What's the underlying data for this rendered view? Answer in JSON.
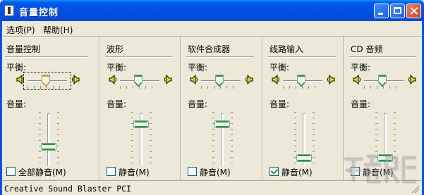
{
  "window": {
    "title": "音量控制"
  },
  "menu": [
    {
      "label": "选项(P)"
    },
    {
      "label": "帮助(H)"
    }
  ],
  "channels": [
    {
      "name": "音量控制",
      "balance_label": "平衡:",
      "volume_label": "音量:",
      "balance": 0.5,
      "volume": 0.35,
      "mute_label": "全部静音(M)",
      "muted": false,
      "focused": true
    },
    {
      "name": "波形",
      "balance_label": "平衡:",
      "volume_label": "音量:",
      "balance": 0.5,
      "volume": 0.85,
      "mute_label": "静音(M)",
      "muted": false,
      "focused": false
    },
    {
      "name": "软件合成器",
      "balance_label": "平衡:",
      "volume_label": "音量:",
      "balance": 0.5,
      "volume": 0.85,
      "mute_label": "静音(M)",
      "muted": false,
      "focused": false
    },
    {
      "name": "线路输入",
      "balance_label": "平衡:",
      "volume_label": "音量:",
      "balance": 0.5,
      "volume": 0.1,
      "mute_label": "静音(M)",
      "muted": true,
      "focused": false
    },
    {
      "name": "CD 音频",
      "balance_label": "平衡:",
      "volume_label": "音量:",
      "balance": 0.5,
      "volume": 0.1,
      "mute_label": "静音(M)",
      "muted": false,
      "focused": false
    }
  ],
  "status": {
    "text": "Creative Sound Blaster PCI"
  },
  "colors": {
    "titlebar": "#0054e3",
    "thumb_accent": "#21a121",
    "background": "#ece9d8"
  }
}
